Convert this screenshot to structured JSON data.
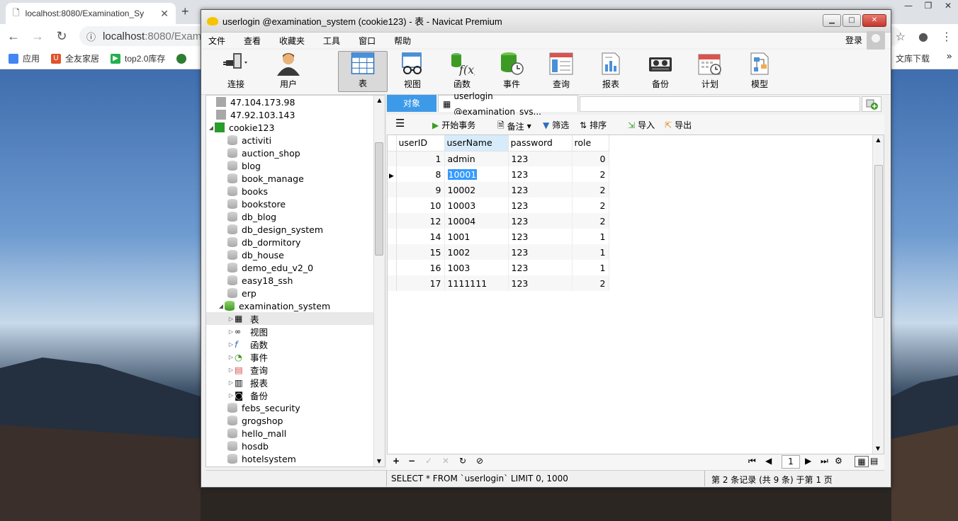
{
  "browser": {
    "tab_title": "localhost:8080/Examination_Sy",
    "new_tab": "+",
    "url_host": "localhost",
    "url_rest": ":8080/Exami",
    "window_controls": [
      "—",
      "❐",
      "✕"
    ]
  },
  "bookmarks": {
    "items": [
      {
        "label": "应用",
        "color": "#4285f4"
      },
      {
        "label": "全友家居",
        "color": "#e0542c"
      },
      {
        "label": "top2.0库存",
        "color": "#22b14c"
      }
    ],
    "right_label": "文库下载",
    "more": "»"
  },
  "navicat": {
    "title": "userlogin @examination_system (cookie123) - 表 - Navicat Premium",
    "window_buttons": [
      "▁",
      "□",
      "✕"
    ],
    "menu": [
      "文件",
      "查看",
      "收藏夹",
      "工具",
      "窗口",
      "帮助"
    ],
    "login": "登录",
    "toolbar": [
      {
        "label": "连接",
        "icon": "plug-icon"
      },
      {
        "label": "用户",
        "icon": "user-icon"
      },
      {
        "label": "表",
        "icon": "table-icon",
        "active": true
      },
      {
        "label": "视图",
        "icon": "view-icon"
      },
      {
        "label": "函数",
        "icon": "function-icon"
      },
      {
        "label": "事件",
        "icon": "event-icon"
      },
      {
        "label": "查询",
        "icon": "query-icon"
      },
      {
        "label": "报表",
        "icon": "report-icon"
      },
      {
        "label": "备份",
        "icon": "backup-icon"
      },
      {
        "label": "计划",
        "icon": "schedule-icon"
      },
      {
        "label": "模型",
        "icon": "model-icon"
      }
    ],
    "tree": {
      "connections": [
        "47.104.173.98",
        "47.92.103.143"
      ],
      "open_connection": "cookie123",
      "databases_before": [
        "activiti",
        "auction_shop",
        "blog",
        "book_manage",
        "books",
        "bookstore",
        "db_blog",
        "db_design_system",
        "db_dormitory",
        "db_house",
        "demo_edu_v2_0",
        "easy18_ssh",
        "erp"
      ],
      "open_database": "examination_system",
      "db_children": [
        "表",
        "视图",
        "函数",
        "事件",
        "查询",
        "报表",
        "备份"
      ],
      "databases_after": [
        "febs_security",
        "grogshop",
        "hello_mall",
        "hosdb",
        "hotelsystem"
      ]
    },
    "tabs": {
      "objects": "对象",
      "table_tab": "userlogin @examination_sys..."
    },
    "grid_toolbar": {
      "begin_tx": "开始事务",
      "comment": "备注",
      "filter": "筛选",
      "sort": "排序",
      "import": "导入",
      "export": "导出"
    },
    "grid": {
      "columns": [
        "userID",
        "userName",
        "password",
        "role"
      ],
      "rows": [
        [
          "1",
          "admin",
          "123",
          "0"
        ],
        [
          "8",
          "10001",
          "123",
          "2"
        ],
        [
          "9",
          "10002",
          "123",
          "2"
        ],
        [
          "10",
          "10003",
          "123",
          "2"
        ],
        [
          "12",
          "10004",
          "123",
          "2"
        ],
        [
          "14",
          "1001",
          "123",
          "1"
        ],
        [
          "15",
          "1002",
          "123",
          "1"
        ],
        [
          "16",
          "1003",
          "123",
          "1"
        ],
        [
          "17",
          "1111111",
          "123",
          "2"
        ]
      ],
      "selected_row": 1,
      "selected_col": 1
    },
    "page_number": "1",
    "status": {
      "sql": "SELECT * FROM `userlogin` LIMIT 0, 1000",
      "record": "第 2 条记录 (共 9 条) 于第 1 页"
    }
  }
}
